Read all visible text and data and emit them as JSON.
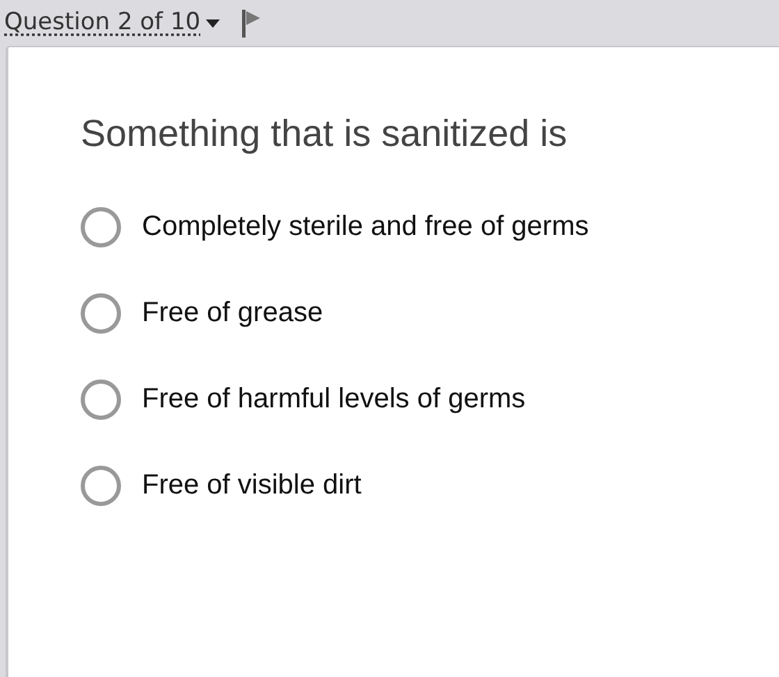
{
  "header": {
    "question_menu": "Question 2 of 10",
    "flagged": false
  },
  "question": {
    "prompt": "Something that is sanitized is",
    "options": [
      {
        "label": "Completely sterile and free of germs",
        "selected": false
      },
      {
        "label": "Free of grease",
        "selected": false
      },
      {
        "label": "Free of harmful levels of germs",
        "selected": false
      },
      {
        "label": "Free of visible dirt",
        "selected": false
      }
    ]
  }
}
